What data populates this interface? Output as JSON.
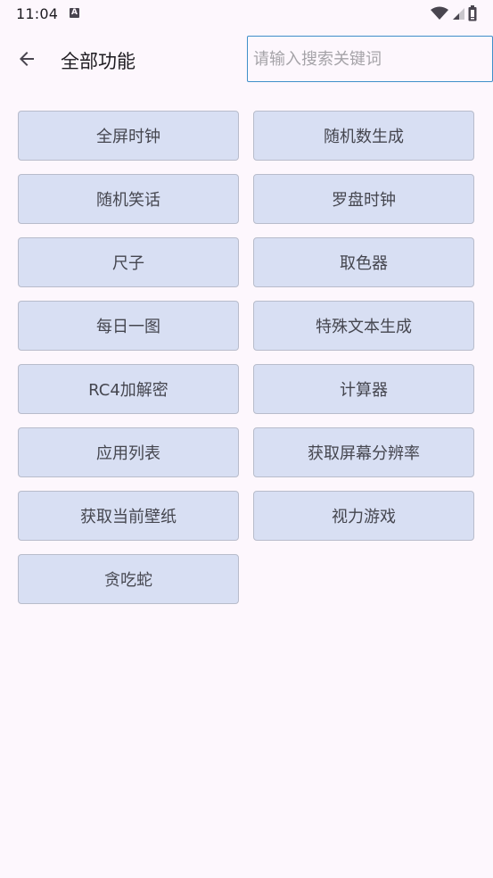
{
  "status_bar": {
    "time": "11:04",
    "notification_icon": "a-icon",
    "status_icons": [
      "wifi-icon",
      "cell-signal-icon",
      "battery-icon"
    ]
  },
  "app_bar": {
    "back_icon": "arrow-left-icon",
    "title": "全部功能",
    "search_placeholder": "请输入搜索关键词",
    "search_value": ""
  },
  "functions": [
    "全屏时钟",
    "随机数生成",
    "随机笑话",
    "罗盘时钟",
    "尺子",
    "取色器",
    "每日一图",
    "特殊文本生成",
    "RC4加解密",
    "计算器",
    "应用列表",
    "获取屏幕分辨率",
    "获取当前壁纸",
    "视力游戏",
    "贪吃蛇"
  ],
  "colors": {
    "background": "#fdf7fd",
    "button_fill": "#d8dff3",
    "button_border": "#b8bccb",
    "search_border": "#3f8fc9",
    "text": "#1d1b20"
  }
}
